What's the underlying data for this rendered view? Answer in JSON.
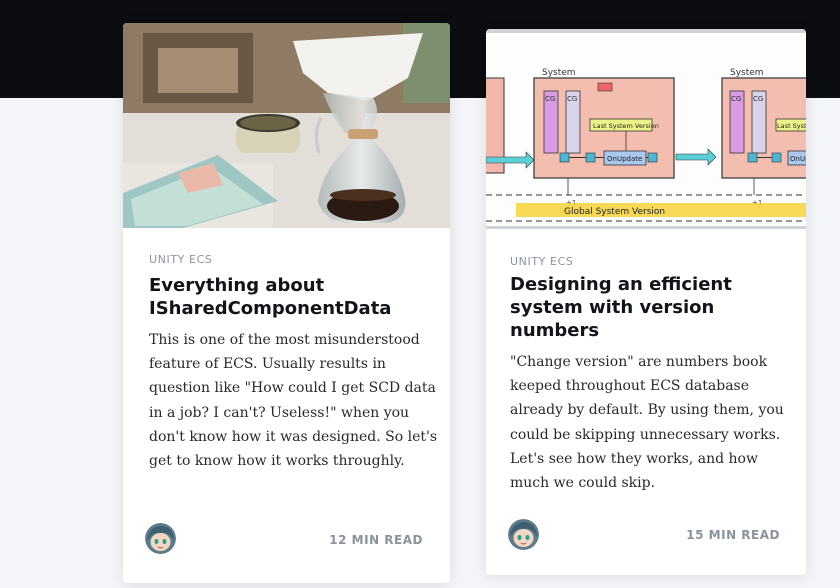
{
  "posts": [
    {
      "category": "UNITY ECS",
      "title": "Everything about ISharedComponentData",
      "excerpt": "This is one of the most misunderstood feature of ECS. Usually results in question like \"How could I get SCD data in a job? I can't? Useless!\" when you don't know how it was designed. So let's get to know how it works throughly.",
      "read_time": "12 MIN READ",
      "image": "coffee-dripper-photo"
    },
    {
      "category": "UNITY ECS",
      "title": "Designing an efficient system with version numbers",
      "excerpt": "\"Change version\" are numbers book keeped throughout ECS database already by default. By using them, you could be skipping unnecessary works. Let's see how they works, and how much we could skip.",
      "read_time": "15 MIN READ",
      "image": "system-version-diagram",
      "diagram_labels": {
        "system_a": "System",
        "system_b": "System",
        "last_system_version": "Last System Version",
        "last_system_version_b": "Last System Version",
        "on_update": "OnUpdate",
        "on_update_b": "OnUpdate",
        "global_system_version": "Global System Version",
        "plus_one": "+1",
        "plus_one_b": "+1"
      }
    }
  ],
  "colors": {
    "header_bg": "#0b0d10",
    "page_bg": "#f3f5f8",
    "card_bg": "#ffffff",
    "meta_text": "#8a939c",
    "title_text": "#111418"
  }
}
